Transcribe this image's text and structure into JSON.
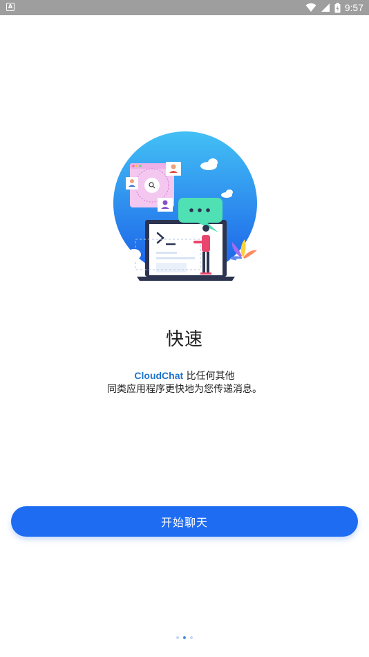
{
  "status_bar": {
    "time": "9:57",
    "app_icon": "A",
    "icons": [
      "wifi-icon",
      "signal-icon",
      "battery-icon"
    ]
  },
  "onboarding": {
    "title": "快速",
    "brand": "CloudChat",
    "desc_line1_rest": " 比任何其他",
    "desc_line2": "同类应用程序更快地为您传递消息。",
    "start_button": "开始聊天",
    "page_count": 3,
    "current_page": 2
  },
  "colors": {
    "accent": "#1e6cf2",
    "brand_text": "#1e74c9",
    "status_bar": "#9e9e9e"
  }
}
